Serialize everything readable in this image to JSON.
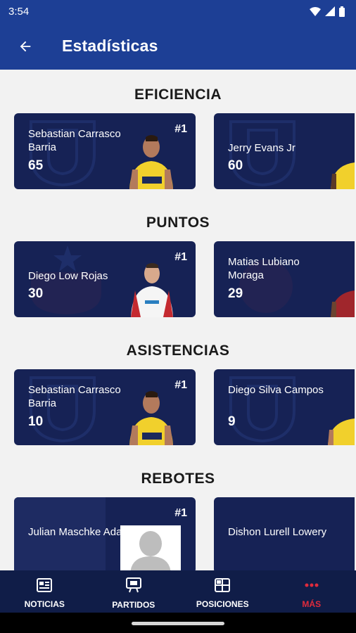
{
  "status": {
    "time": "3:54"
  },
  "appbar": {
    "title": "Estadísticas"
  },
  "sections": [
    {
      "title": "EFICIENCIA",
      "cards": [
        {
          "name": "Sebastian Carrasco Barria",
          "value": "65",
          "rank": "#1"
        },
        {
          "name": "Jerry Evans Jr",
          "value": "60"
        }
      ]
    },
    {
      "title": "PUNTOS",
      "cards": [
        {
          "name": "Diego Low Rojas",
          "value": "30",
          "rank": "#1"
        },
        {
          "name": "Matias Lubiano Moraga",
          "value": "29"
        }
      ]
    },
    {
      "title": "ASISTENCIAS",
      "cards": [
        {
          "name": "Sebastian Carrasco Barria",
          "value": "10",
          "rank": "#1"
        },
        {
          "name": "Diego Silva Campos",
          "value": "9"
        }
      ]
    },
    {
      "title": "REBOTES",
      "cards": [
        {
          "name": "Julian Maschke Adaro",
          "rank": "#1"
        },
        {
          "name": "Dishon Lurell Lowery"
        }
      ]
    }
  ],
  "bottom_nav": [
    {
      "label": "NOTICIAS",
      "icon": "newspaper-icon"
    },
    {
      "label": "PARTIDOS",
      "icon": "scoreboard-icon"
    },
    {
      "label": "POSICIONES",
      "icon": "table-icon"
    },
    {
      "label": "MÁS",
      "icon": "more-dots-icon",
      "active": true
    }
  ],
  "colors": {
    "primary": "#1d3f95",
    "card": "#162255",
    "nav": "#101d48",
    "accent": "#e02b3c"
  }
}
